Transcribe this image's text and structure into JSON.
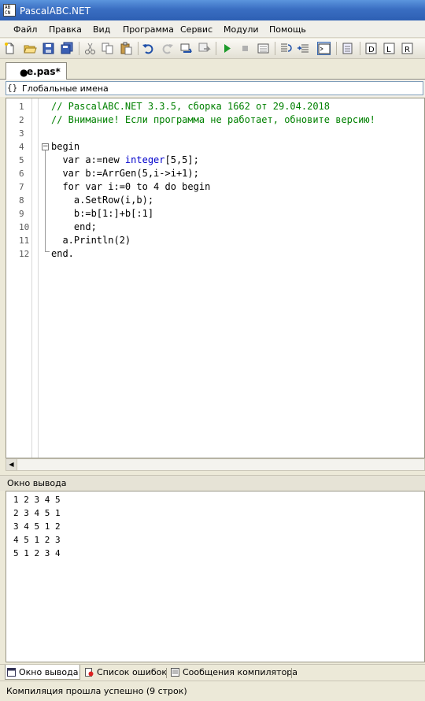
{
  "window": {
    "title": "PascalABC.NET",
    "app_icon_text": "AB\nCN"
  },
  "menu": [
    "Файл",
    "Правка",
    "Вид",
    "Программа",
    "Сервис",
    "Модули",
    "Помощь"
  ],
  "tab": {
    "label": "e.pas*",
    "modified_marker": "●"
  },
  "navigation": {
    "icon_text": "{}",
    "text": "Глобальные имена"
  },
  "editor": {
    "line_numbers": [
      "1",
      "2",
      "3",
      "4",
      "5",
      "6",
      "7",
      "8",
      "9",
      "10",
      "11",
      "12"
    ],
    "lines": [
      [
        {
          "t": "// PascalABC.NET 3.3.5, сборка 1662 от 29.04.2018",
          "c": "comment"
        }
      ],
      [
        {
          "t": "// Внимание! Если программа не работает, обновите версию!",
          "c": "comment"
        }
      ],
      [],
      [
        {
          "t": "begin",
          "c": "kw"
        }
      ],
      [
        {
          "t": "  var a:=new ",
          "c": "kw"
        },
        {
          "t": "integer",
          "c": "type"
        },
        {
          "t": "[5,5];",
          "c": "kw"
        }
      ],
      [
        {
          "t": "  var b:=ArrGen(5,i->i+1);",
          "c": "kw"
        }
      ],
      [
        {
          "t": "  for var i:=0 to 4 do begin",
          "c": "kw"
        }
      ],
      [
        {
          "t": "    a.SetRow(i,b);",
          "c": "kw"
        }
      ],
      [
        {
          "t": "    b:=b[1:]+b[:1]",
          "c": "kw"
        }
      ],
      [
        {
          "t": "    end;",
          "c": "kw"
        }
      ],
      [
        {
          "t": "  a.Println(2)",
          "c": "kw"
        }
      ],
      [
        {
          "t": "end.",
          "c": "kw"
        }
      ]
    ]
  },
  "output": {
    "title": "Окно вывода",
    "lines": [
      "1 2 3 4 5",
      "2 3 4 5 1",
      "3 4 5 1 2",
      "4 5 1 2 3",
      "5 1 2 3 4"
    ]
  },
  "bottom_tabs": [
    "Окно вывода",
    "Список ошибок",
    "Сообщения компилятора"
  ],
  "status": "Компиляция прошла успешно (9 строк)",
  "colors": {
    "comment": "#008000",
    "type": "#0000cc",
    "title_bar": "#3a6ec2"
  },
  "toolbar_icons": [
    "new-file-icon",
    "open-file-icon",
    "save-icon",
    "save-all-icon",
    "cut-icon",
    "copy-icon",
    "paste-icon",
    "undo-icon",
    "redo-icon",
    "build-icon",
    "compile-icon",
    "run-icon",
    "stop-icon",
    "debug-icon",
    "step-over-icon",
    "step-into-icon",
    "output-window-icon",
    "form-designer-icon",
    "indent-icon",
    "format-left-icon",
    "format-right-icon"
  ]
}
